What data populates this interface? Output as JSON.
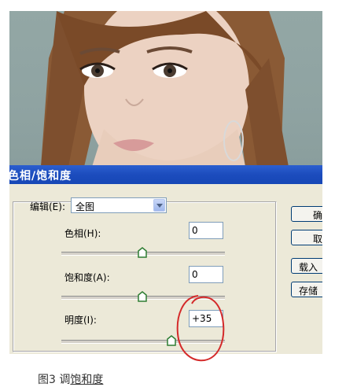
{
  "dialog": {
    "title": "色相/饱和度",
    "edit_label": "编辑(E):",
    "edit_value": "全图",
    "hue": {
      "label": "色相(H):",
      "value": "0",
      "slider_fraction": 0.5
    },
    "saturation": {
      "label": "饱和度(A):",
      "value": "0",
      "slider_fraction": 0.5
    },
    "lightness": {
      "label": "明度(I):",
      "value": "+35",
      "slider_fraction": 0.675
    },
    "buttons": {
      "ok": "确",
      "cancel": "取",
      "load": "载入",
      "save": "存储"
    }
  },
  "caption": {
    "prefix": "图3 调",
    "link": "饱和度"
  },
  "colors": {
    "titlebar": "#1c4cbd",
    "dialog_bg": "#ece9d8",
    "annotation": "#d42a2a"
  }
}
